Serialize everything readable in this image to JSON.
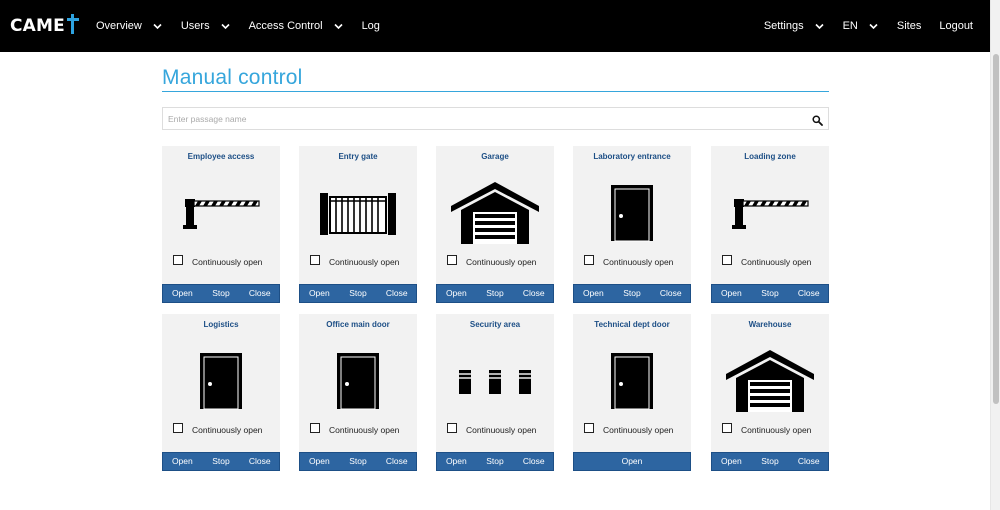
{
  "brand": {
    "name": "CAME",
    "mark_color": "#2ea3e0"
  },
  "nav": {
    "left": [
      {
        "label": "Overview",
        "dropdown": true
      },
      {
        "label": "Users",
        "dropdown": true
      },
      {
        "label": "Access Control",
        "dropdown": true
      },
      {
        "label": "Log",
        "dropdown": false
      }
    ],
    "right": [
      {
        "label": "Settings",
        "dropdown": true
      },
      {
        "label": "EN",
        "dropdown": true
      },
      {
        "label": "Sites",
        "dropdown": false
      },
      {
        "label": "Logout",
        "dropdown": false
      }
    ]
  },
  "page": {
    "title": "Manual control",
    "accent": "#36a6dc"
  },
  "search": {
    "placeholder": "Enter passage name",
    "value": "",
    "icon": "search-icon"
  },
  "checkbox_label": "Continuously open",
  "button_color": "#2d65a1",
  "passages": [
    {
      "title": "Employee access",
      "icon": "barrier",
      "buttons": [
        "Open",
        "Stop",
        "Close"
      ],
      "continuously_open": false
    },
    {
      "title": "Entry gate",
      "icon": "gate",
      "buttons": [
        "Open",
        "Stop",
        "Close"
      ],
      "continuously_open": false
    },
    {
      "title": "Garage",
      "icon": "garage",
      "buttons": [
        "Open",
        "Stop",
        "Close"
      ],
      "continuously_open": false
    },
    {
      "title": "Laboratory entrance",
      "icon": "door",
      "buttons": [
        "Open",
        "Stop",
        "Close"
      ],
      "continuously_open": false
    },
    {
      "title": "Loading zone",
      "icon": "barrier",
      "buttons": [
        "Open",
        "Stop",
        "Close"
      ],
      "continuously_open": false
    },
    {
      "title": "Logistics",
      "icon": "door",
      "buttons": [
        "Open",
        "Stop",
        "Close"
      ],
      "continuously_open": false
    },
    {
      "title": "Office main door",
      "icon": "door",
      "buttons": [
        "Open",
        "Stop",
        "Close"
      ],
      "continuously_open": false
    },
    {
      "title": "Security area",
      "icon": "bollards",
      "buttons": [
        "Open",
        "Stop",
        "Close"
      ],
      "continuously_open": false
    },
    {
      "title": "Technical dept door",
      "icon": "door",
      "buttons": [
        "Open"
      ],
      "continuously_open": false
    },
    {
      "title": "Warehouse",
      "icon": "garage",
      "buttons": [
        "Open",
        "Stop",
        "Close"
      ],
      "continuously_open": false
    }
  ]
}
